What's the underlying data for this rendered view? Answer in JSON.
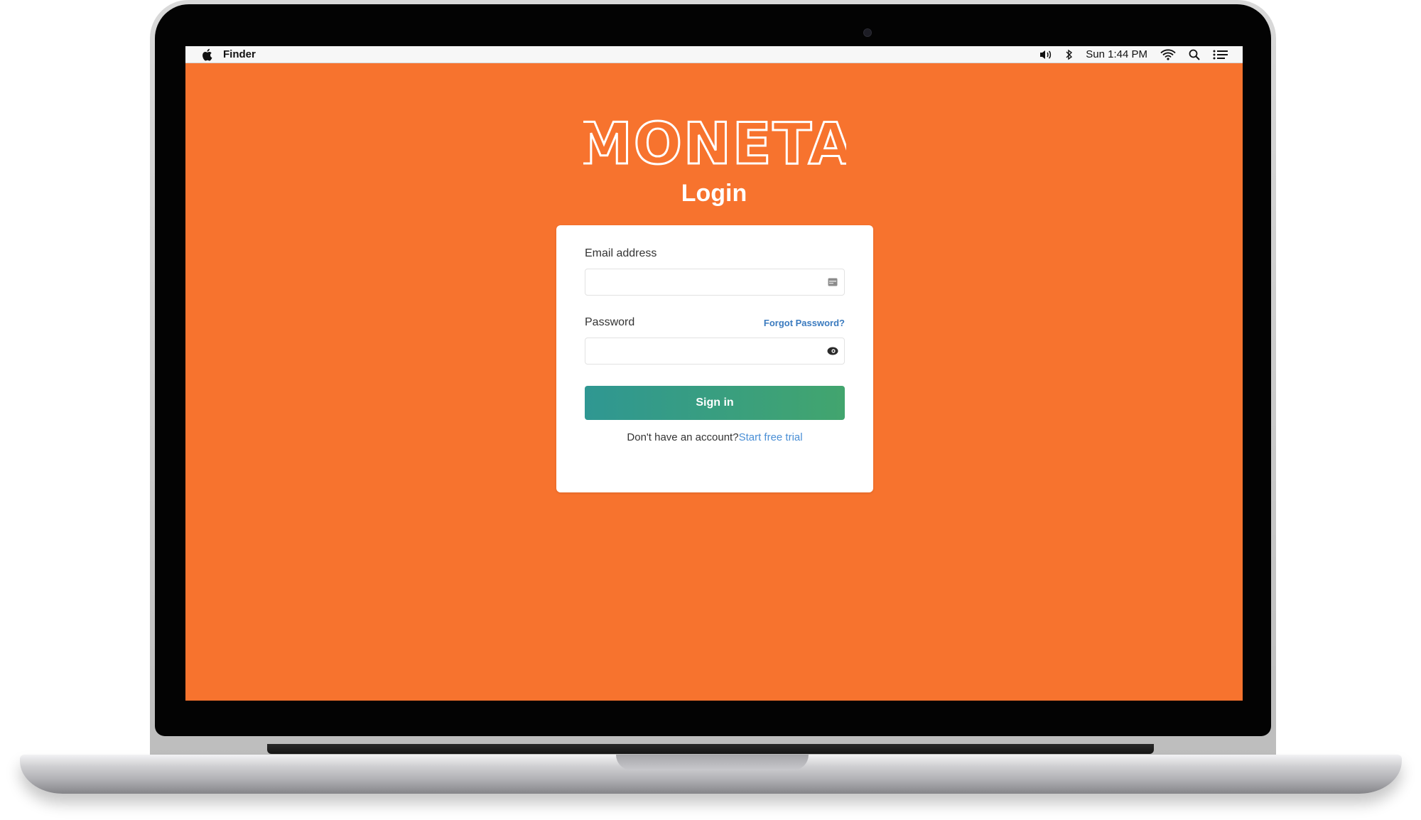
{
  "menubar": {
    "app_name": "Finder",
    "clock": "Sun 1:44 PM"
  },
  "app": {
    "logo_text": "MONETA",
    "title": "Login"
  },
  "form": {
    "email_label": "Email address",
    "email_value": "",
    "password_label": "Password",
    "password_value": "",
    "forgot_link": "Forgot Password?",
    "signin_button": "Sign in",
    "signup_prompt": "Don't have an account?",
    "signup_link": "Start free trial"
  },
  "colors": {
    "background": "#f7732e",
    "button_start": "#2f9792",
    "button_end": "#42a56e",
    "link": "#3b7bbf"
  }
}
